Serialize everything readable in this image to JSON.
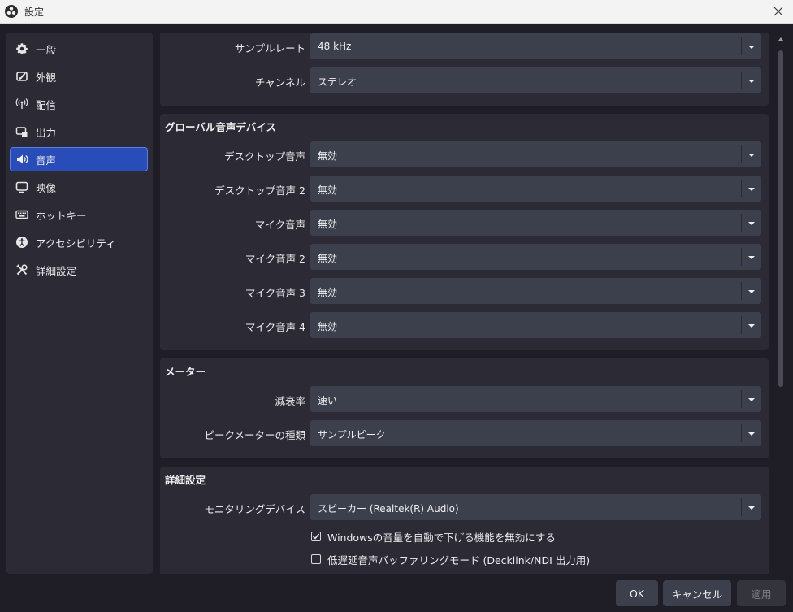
{
  "window": {
    "title": "設定"
  },
  "sidebar": {
    "items": [
      {
        "label": "一般",
        "icon": "gear-icon"
      },
      {
        "label": "外観",
        "icon": "appearance-icon"
      },
      {
        "label": "配信",
        "icon": "broadcast-icon"
      },
      {
        "label": "出力",
        "icon": "output-icon"
      },
      {
        "label": "音声",
        "icon": "speaker-icon",
        "active": true
      },
      {
        "label": "映像",
        "icon": "monitor-icon"
      },
      {
        "label": "ホットキー",
        "icon": "keyboard-icon"
      },
      {
        "label": "アクセシビリティ",
        "icon": "accessibility-icon"
      },
      {
        "label": "詳細設定",
        "icon": "tools-icon"
      }
    ]
  },
  "general": {
    "sample_rate": {
      "label": "サンプルレート",
      "value": "48 kHz"
    },
    "channels": {
      "label": "チャンネル",
      "value": "ステレオ"
    }
  },
  "global_audio": {
    "title": "グローバル音声デバイス",
    "rows": [
      {
        "label": "デスクトップ音声",
        "value": "無効"
      },
      {
        "label": "デスクトップ音声 2",
        "value": "無効"
      },
      {
        "label": "マイク音声",
        "value": "無効"
      },
      {
        "label": "マイク音声 2",
        "value": "無効"
      },
      {
        "label": "マイク音声 3",
        "value": "無効"
      },
      {
        "label": "マイク音声 4",
        "value": "無効"
      }
    ]
  },
  "meters": {
    "title": "メーター",
    "decay": {
      "label": "減衰率",
      "value": "速い"
    },
    "peak_type": {
      "label": "ピークメーターの種類",
      "value": "サンプルピーク"
    }
  },
  "advanced": {
    "title": "詳細設定",
    "monitoring": {
      "label": "モニタリングデバイス",
      "value": "スピーカー (Realtek(R) Audio)"
    },
    "disable_ducking": {
      "label": "Windowsの音量を自動で下げる機能を無効にする",
      "checked": true
    },
    "low_latency": {
      "label": "低遅延音声バッファリングモード (Decklink/NDI 出力用)",
      "checked": false
    }
  },
  "footer": {
    "ok": "OK",
    "cancel": "キャンセル",
    "apply": "適用"
  },
  "colors": {
    "background": "#1f1e27",
    "panel": "#2b2a35",
    "control": "#3c404d",
    "accent": "#284cb8"
  }
}
